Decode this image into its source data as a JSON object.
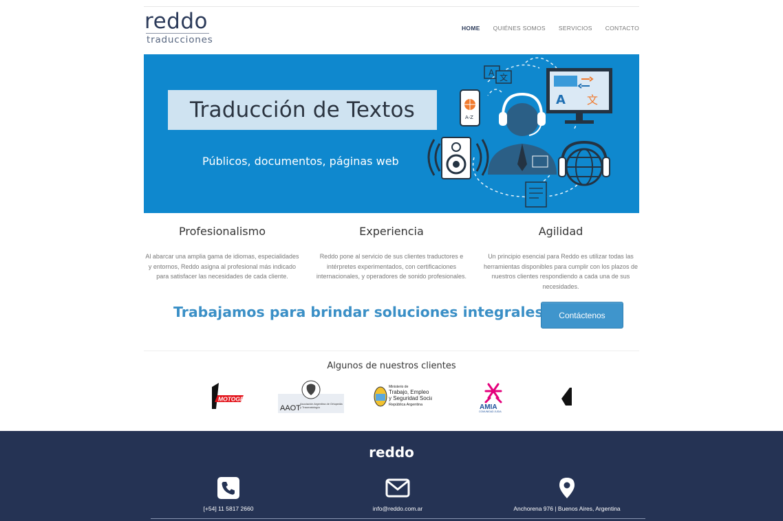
{
  "header": {
    "logo_main": "reddo",
    "logo_sub": "traducciones",
    "nav": [
      {
        "label": "HOME",
        "active": true
      },
      {
        "label": "QUIÉNES SOMOS",
        "active": false
      },
      {
        "label": "SERVICIOS",
        "active": false
      },
      {
        "label": "CONTACTO",
        "active": false
      }
    ]
  },
  "hero": {
    "title": "Traducción de Textos",
    "subtitle": "Públicos, documentos, páginas web",
    "bg_color": "#0f88ce"
  },
  "features": [
    {
      "title": "Profesionalismo",
      "text": "Al abarcar una amplia gama de idiomas, especialidades y entornos, Reddo asigna al profesional más indicado para satisfacer las necesidades de cada cliente."
    },
    {
      "title": "Experiencia",
      "text": "Reddo pone al servicio de sus clientes traductores e intérpretes experimentados, con certificaciones internacionales, y operadores de sonido profesionales."
    },
    {
      "title": "Agilidad",
      "text": "Un principio esencial para Reddo es utilizar todas las herramientas disponibles para cumplir con los plazos de nuestros clientes respondiendo a cada una de sus necesidades."
    }
  ],
  "cta": {
    "text": "Trabajamos para brindar soluciones integrales",
    "button": "Contáctenos"
  },
  "clients": {
    "title": "Algunos de nuestros clientes",
    "logos": [
      {
        "name": "motogp-logo",
        "text": "MOTOGP"
      },
      {
        "name": "aaot-logo",
        "text": "AAOT",
        "sub": "Asociación Argentina de Ortopedia y Traumatología"
      },
      {
        "name": "ministerio-logo",
        "lines": [
          "Ministerio de",
          "Trabajo, Empleo",
          "y Seguridad Social",
          "República Argentina"
        ]
      },
      {
        "name": "amia-logo",
        "text": "AMIA",
        "sub": "COMUNIDAD JUDIA"
      }
    ]
  },
  "footer": {
    "brand": "reddo",
    "phone": "[+54] 11 5817 2660",
    "email": "info@reddo.com.ar",
    "address": "Anchorena 976 | Buenos Aires, Argentina",
    "bg_color": "#253354"
  }
}
